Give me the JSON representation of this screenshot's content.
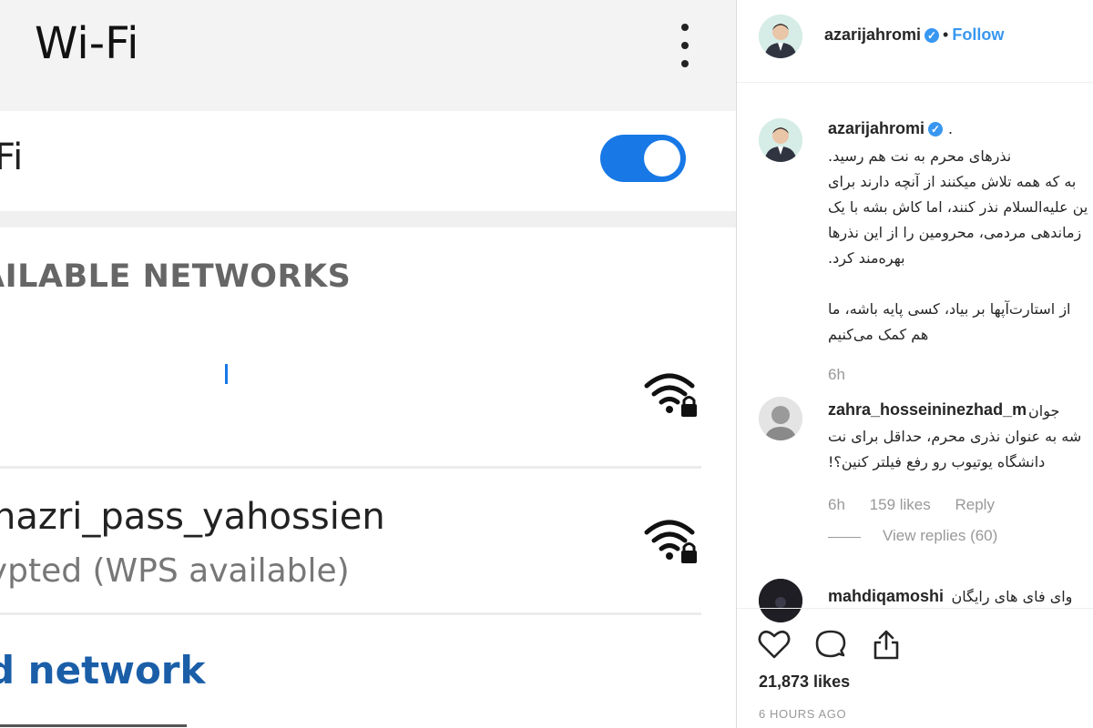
{
  "wifi_screen": {
    "title": "Wi-Fi",
    "toggle_label": "Fi",
    "toggle_state": "on",
    "section_header": "AILABLE NETWORKS",
    "networks": [
      {
        "name": "",
        "status": "",
        "icon": "wifi-lock-icon"
      },
      {
        "name": "_nazri_pass_yahossien",
        "status": "rypted (WPS available)",
        "icon": "wifi-lock-icon"
      }
    ],
    "add_network": "d network",
    "colors": {
      "accent": "#1778e6",
      "link": "#1a5ea8",
      "appbar": "#f3f3f3"
    }
  },
  "instagram": {
    "header": {
      "username": "azarijahromi",
      "follow_label": "Follow",
      "separator": "•"
    },
    "caption": {
      "username": "azarijahromi",
      "suffix": ".",
      "lines": [
        ".نذرهای محرم به نت هم رسید",
        "به که همه تلاش میکنند از آنچه دارند برای",
        "ین علیه‌السلام نذر کنند، اما کاش بشه با یک",
        "زماندهی مردمی، محرومین را از این نذرها",
        ".بهره‌مند کرد",
        "",
        "از استارت‌آپها بر بیاد، کسی پایه باشه، ما",
        "هم کمک می‌کنیم"
      ],
      "time": "6h"
    },
    "comments": [
      {
        "username": "zahra_hosseininezhad_m",
        "lines": [
          "جوان",
          "شه به عنوان نذری محرم، حداقل برای نت",
          "!دانشگاه یوتیوب رو رفع فیلتر کنین؟"
        ],
        "time": "6h",
        "likes": "159 likes",
        "reply_label": "Reply",
        "view_replies": "View replies (60)"
      },
      {
        "username": "mahdiqamoshi",
        "lines": [
          "وای فای های رایگان"
        ]
      }
    ],
    "actions": {
      "icons": [
        "heart-icon",
        "comment-icon",
        "share-icon"
      ],
      "likes": "21,873 likes",
      "posted": "6 HOURS AGO"
    },
    "colors": {
      "link": "#3897f0",
      "muted": "#999999",
      "text": "#262626"
    }
  }
}
